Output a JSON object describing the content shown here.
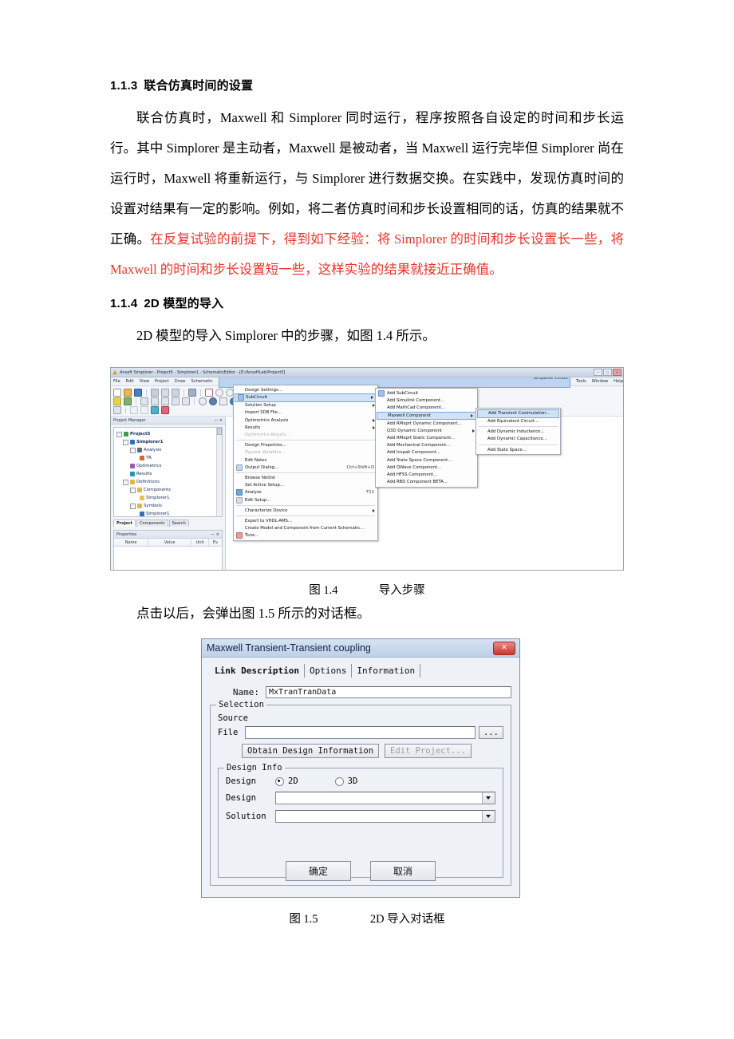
{
  "document": {
    "sections": [
      {
        "number": "1.1.3",
        "title": "联合仿真时间的设置",
        "paragraph_black": "联合仿真时，Maxwell 和 Simplorer 同时运行，程序按照各自设定的时间和步长运行。其中 Simplorer 是主动者，Maxwell 是被动者，当 Maxwell 运行完毕但 Simplorer 尚在运行时，Maxwell 将重新运行，与 Simplorer 进行数据交换。在实践中，发现仿真时间的设置对结果有一定的影响。例如，将二者仿真时间和步长设置相同的话，仿真的结果就不正确。",
        "paragraph_red": "在反复试验的前提下，得到如下经验：将 Simplorer 的时间和步长设置长一些，将 Maxwell 的时间和步长设置短一些，这样实验的结果就接近正确值。"
      },
      {
        "number": "1.1.4",
        "title": "2D 模型的导入",
        "paragraph": "2D 模型的导入 Simplorer 中的步骤，如图 1.4 所示。"
      }
    ],
    "text_after_fig14": "点击以后，会弹出图 1.5 所示的对话框。",
    "caption_fig14_label": "图 1.4",
    "caption_fig14_text": "导入步骤",
    "caption_fig15_label": "图 1.5",
    "caption_fig15_text": "2D 导入对话框",
    "red_color": "#e8342a"
  },
  "figure_14": {
    "window_title": "Ansoft Simplorer  - Project5 - Simplorer1 - SchematicEditor - [E:/AnsoftLab/Project5]",
    "window_buttons": [
      "—",
      "□",
      "✕"
    ],
    "menubar": [
      "File",
      "Edit",
      "View",
      "Project",
      "Draw",
      "Schematic",
      "Simplorer Circuit",
      "Tools",
      "Window",
      "Help"
    ],
    "menubar_selected": "Simplorer Circuit",
    "project_manager": {
      "panel_title": "Project Manager",
      "tree": [
        {
          "label": "Project5",
          "depth": 0,
          "icon": "#37a24a",
          "bold": true
        },
        {
          "label": "Simplorer1",
          "depth": 1,
          "icon": "#2f6fbf",
          "bold": true
        },
        {
          "label": "Analysis",
          "depth": 2,
          "icon": "#5b6b7d",
          "bold": false
        },
        {
          "label": "TR",
          "depth": 3,
          "icon": "#d06a2a",
          "bold": false
        },
        {
          "label": "Optimetrics",
          "depth": 2,
          "icon": "#9b59b6",
          "bold": false
        },
        {
          "label": "Results",
          "depth": 2,
          "icon": "#2f8fbf",
          "bold": false
        },
        {
          "label": "Definitions",
          "depth": 1,
          "icon": "#e0b64a",
          "bold": false
        },
        {
          "label": "Components",
          "depth": 2,
          "icon": "#e0b64a",
          "bold": false
        },
        {
          "label": "Simplorer1",
          "depth": 3,
          "icon": "#e8c34a",
          "bold": false
        },
        {
          "label": "Symbols",
          "depth": 2,
          "icon": "#e0b64a",
          "bold": false
        },
        {
          "label": "Simplorer1",
          "depth": 3,
          "icon": "#2f6fbf",
          "bold": false
        }
      ],
      "tabs": [
        "Project",
        "Components",
        "Search"
      ],
      "tab_active": "Project"
    },
    "properties_panel": {
      "panel_title": "Properties",
      "columns": [
        "Name",
        "Value",
        "Unit",
        "Ev"
      ]
    },
    "menu_simplorer_circuit": [
      {
        "label": "Design Settings...",
        "arrow": false,
        "disabled": false,
        "highlight": false,
        "shortcut": ""
      },
      {
        "label": "SubCircuit",
        "arrow": true,
        "disabled": false,
        "highlight": true,
        "shortcut": ""
      },
      {
        "label": "Solution Setup",
        "arrow": true,
        "disabled": false,
        "highlight": false,
        "shortcut": ""
      },
      {
        "label": "Import SDB File...",
        "arrow": false,
        "disabled": false,
        "highlight": false,
        "shortcut": ""
      },
      {
        "label": "Optimetrics Analysis",
        "arrow": true,
        "disabled": false,
        "highlight": false,
        "shortcut": ""
      },
      {
        "label": "Results",
        "arrow": true,
        "disabled": false,
        "highlight": false,
        "shortcut": ""
      },
      {
        "label": "Optimetrics Results...",
        "arrow": false,
        "disabled": true,
        "highlight": false,
        "shortcut": ""
      },
      {
        "label": "Design Properties...",
        "arrow": false,
        "disabled": false,
        "highlight": false,
        "shortcut": "",
        "sep_before": true
      },
      {
        "label": "Figured Variables...",
        "arrow": false,
        "disabled": true,
        "highlight": false,
        "shortcut": ""
      },
      {
        "label": "Edit Notes",
        "arrow": false,
        "disabled": false,
        "highlight": false,
        "shortcut": ""
      },
      {
        "label": "Output Dialog...",
        "arrow": false,
        "disabled": false,
        "highlight": false,
        "shortcut": "Ctrl+Shift+O"
      },
      {
        "label": "Browse Netlist",
        "arrow": false,
        "disabled": false,
        "highlight": false,
        "shortcut": "",
        "sep_before": true
      },
      {
        "label": "Set Active Setup...",
        "arrow": false,
        "disabled": false,
        "highlight": false,
        "shortcut": ""
      },
      {
        "label": "Analyze",
        "arrow": false,
        "disabled": false,
        "highlight": false,
        "shortcut": "F11"
      },
      {
        "label": "Edit Setup...",
        "arrow": false,
        "disabled": false,
        "highlight": false,
        "shortcut": ""
      },
      {
        "label": "Characterize Device",
        "arrow": true,
        "disabled": false,
        "highlight": false,
        "shortcut": "",
        "sep_before": true
      },
      {
        "label": "Export to VHDL-AMS...",
        "arrow": false,
        "disabled": false,
        "highlight": false,
        "shortcut": "",
        "sep_before": true
      },
      {
        "label": "Create Model and Component from Current Schematic...",
        "arrow": false,
        "disabled": false,
        "highlight": false,
        "shortcut": ""
      },
      {
        "label": "Tune...",
        "arrow": false,
        "disabled": false,
        "highlight": false,
        "shortcut": ""
      }
    ],
    "menu_subcircuit": [
      {
        "label": "Add SubCircuit",
        "arrow": false,
        "highlight": false
      },
      {
        "label": "Add Simulink Component...",
        "arrow": false,
        "highlight": false
      },
      {
        "label": "Add MathCad Component...",
        "arrow": false,
        "highlight": false
      },
      {
        "label": "Maxwell Component",
        "arrow": true,
        "highlight": true
      },
      {
        "label": "Add RMxprt Dynamic Component...",
        "arrow": false,
        "highlight": false
      },
      {
        "label": "Q3D Dynamic Component",
        "arrow": true,
        "highlight": false
      },
      {
        "label": "Add RMxprt Static Component...",
        "arrow": false,
        "highlight": false
      },
      {
        "label": "Add Mechanical Component...",
        "arrow": false,
        "highlight": false
      },
      {
        "label": "Add Icepak Component...",
        "arrow": false,
        "highlight": false
      },
      {
        "label": "Add State Space Component...",
        "arrow": false,
        "highlight": false
      },
      {
        "label": "Add QWave Component...",
        "arrow": false,
        "highlight": false
      },
      {
        "label": "Add HFSS Component...",
        "arrow": false,
        "highlight": false
      },
      {
        "label": "Add RBD Component BETA...",
        "arrow": false,
        "highlight": false
      }
    ],
    "menu_maxwell_component": [
      {
        "label": "Add Transient Cosimulation...",
        "highlight": true
      },
      {
        "label": "Add Equivalent Circuit...",
        "highlight": false
      },
      {
        "label": "Add Dynamic Inductance...",
        "highlight": false,
        "sep_before": true
      },
      {
        "label": "Add Dynamic Capacitance...",
        "highlight": false
      },
      {
        "label": "Add State Space...",
        "highlight": false,
        "sep_before": true
      }
    ]
  },
  "figure_15": {
    "title": "Maxwell Transient-Transient coupling",
    "close_label": "✕",
    "tabs": [
      "Link Description",
      "Options",
      "Information"
    ],
    "tab_active": "Link Description",
    "name_label": "Name:",
    "name_value": "MxTranTranData",
    "selection_legend": "Selection",
    "source_label": "Source",
    "file_label": "File",
    "file_value": "",
    "browse_label": "...",
    "obtain_button": "Obtain Design Information",
    "edit_project_button": "Edit Project...",
    "design_info_legend": "Design Info",
    "design_type_label": "Design",
    "radio_2d": "2D",
    "radio_3d": "3D",
    "radio_selected": "2D",
    "design_label": "Design",
    "design_value": "",
    "solution_label": "Solution",
    "solution_value": "",
    "ok_button": "确定",
    "cancel_button": "取消"
  }
}
